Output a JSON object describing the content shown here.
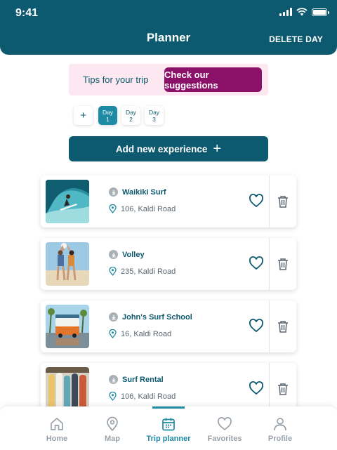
{
  "status": {
    "time": "9:41"
  },
  "header": {
    "title": "Planner",
    "delete_label": "DELETE DAY"
  },
  "tips": {
    "text": "Tips for your trip",
    "button_label": "Check our suggestions"
  },
  "days": {
    "add_label": "+",
    "items": [
      {
        "label": "Day",
        "num": "1",
        "active": true
      },
      {
        "label": "Day",
        "num": "2",
        "active": false
      },
      {
        "label": "Day",
        "num": "3",
        "active": false
      }
    ]
  },
  "add_experience": {
    "label": "Add new experience",
    "icon": "plus-icon"
  },
  "experiences": [
    {
      "name": "Waikiki Surf",
      "address": "106, Kaldi Road",
      "image": "surfer-wave-photo"
    },
    {
      "name": "Volley",
      "address": "235, Kaldi Road",
      "image": "volleyball-players-photo"
    },
    {
      "name": "John's Surf School",
      "address": "16, Kaldi Road",
      "image": "surf-van-photo"
    },
    {
      "name": "Surf Rental",
      "address": "106, Kaldi Road",
      "image": "surfboard-rack-photo"
    }
  ],
  "bottom_nav": [
    {
      "label": "Home",
      "icon": "home-icon",
      "active": false
    },
    {
      "label": "Map",
      "icon": "map-pin-icon",
      "active": false
    },
    {
      "label": "Trip planner",
      "icon": "calendar-icon",
      "active": true
    },
    {
      "label": "Favorites",
      "icon": "heart-icon",
      "active": false
    },
    {
      "label": "Profile",
      "icon": "user-icon",
      "active": false
    }
  ],
  "colors": {
    "primary": "#0d5a70",
    "accent": "#1f8aa3",
    "magenta": "#8b1068",
    "pink_bg": "#fde8f2"
  }
}
